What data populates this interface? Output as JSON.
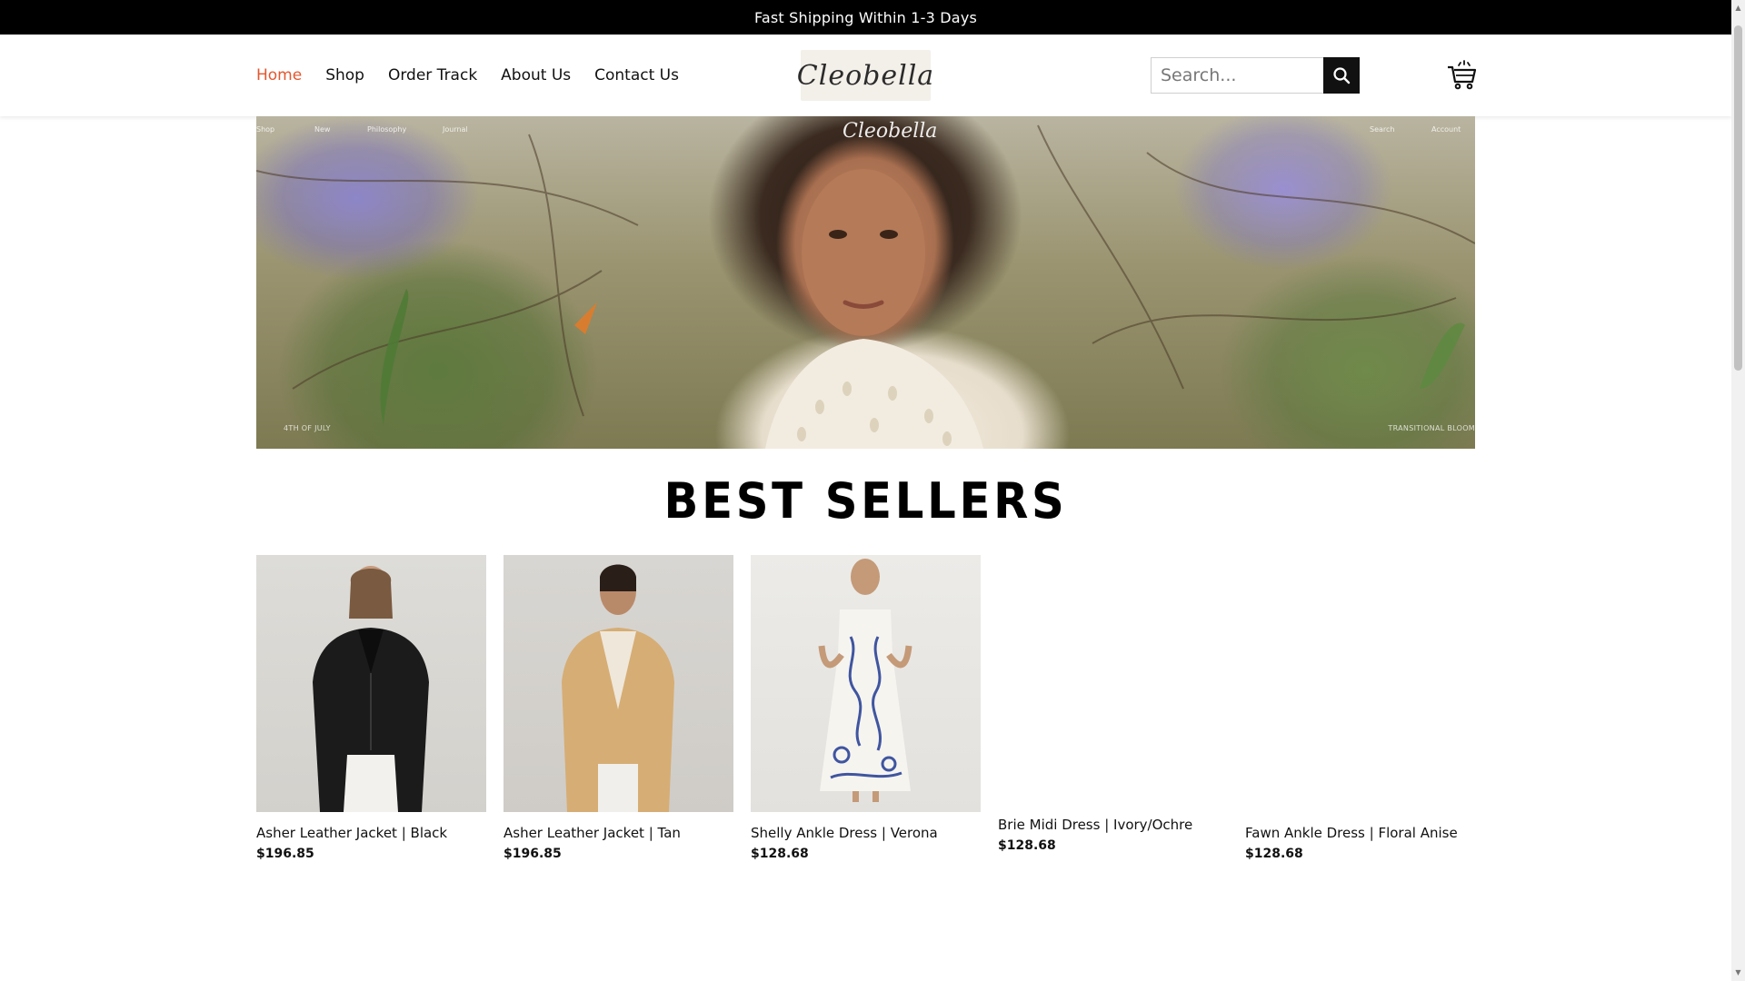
{
  "announcement": "Fast Shipping Within 1-3 Days",
  "nav": {
    "items": [
      {
        "label": "Home",
        "active": true
      },
      {
        "label": "Shop",
        "active": false
      },
      {
        "label": "Order Track",
        "active": false
      },
      {
        "label": "About Us",
        "active": false
      },
      {
        "label": "Contact Us",
        "active": false
      }
    ]
  },
  "brand": {
    "logo_text": "Cleobella"
  },
  "search": {
    "placeholder": "Search...",
    "icon": "search-icon"
  },
  "cart": {
    "icon": "cart-icon"
  },
  "hero": {
    "logo_text": "Cleobella",
    "mini_nav": [
      "Shop",
      "New",
      "Philosophy",
      "Journal",
      "Search",
      "Account"
    ],
    "bottom_left": "4TH OF JULY",
    "bottom_right": "TRANSITIONAL BLOOM"
  },
  "section": {
    "title": "BEST SELLERS"
  },
  "products": [
    {
      "name": "Asher Leather Jacket | Black",
      "price": "$196.85"
    },
    {
      "name": "Asher Leather Jacket | Tan",
      "price": "$196.85"
    },
    {
      "name": "Shelly Ankle Dress | Verona",
      "price": "$128.68"
    },
    {
      "name": "Brie Midi Dress | Ivory/Ochre",
      "price": "$128.68"
    },
    {
      "name": "Fawn Ankle Dress | Floral Anise",
      "price": "$128.68"
    }
  ],
  "colors": {
    "accent": "#e4572e",
    "announcement_bg": "#000000",
    "text": "#111111"
  }
}
